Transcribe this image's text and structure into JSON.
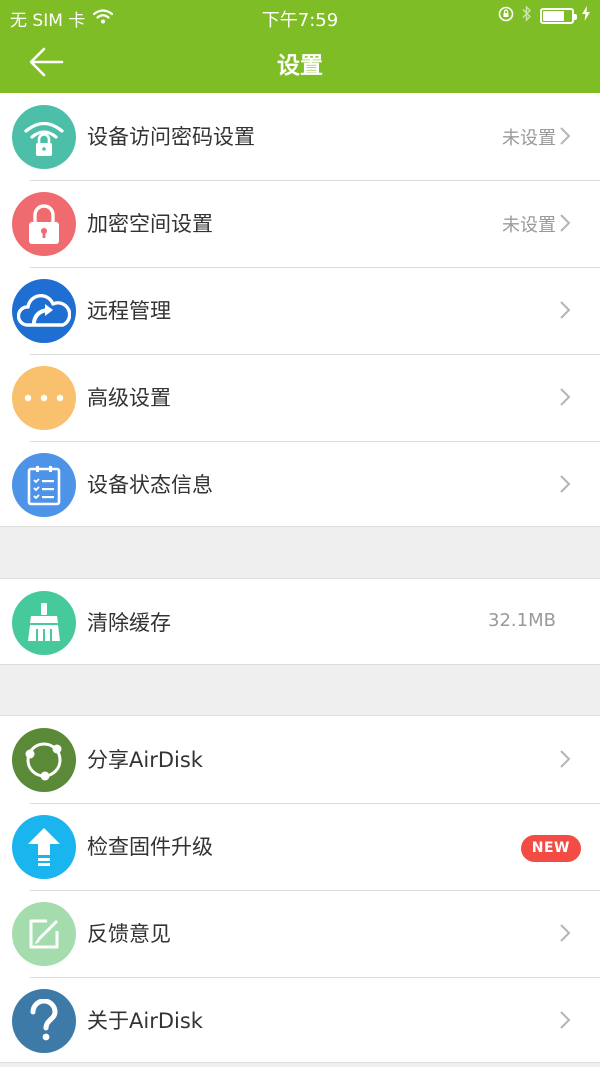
{
  "status_bar": {
    "carrier": "无 SIM 卡",
    "time": "下午7:59",
    "battery_level_percent": 75,
    "icons": [
      "wifi-icon",
      "orientation-lock-icon",
      "bluetooth-icon",
      "battery-icon",
      "charging-icon"
    ]
  },
  "nav": {
    "title": "设置",
    "back_icon": "back-arrow-icon"
  },
  "colors": {
    "nav_background": "#7fbd26",
    "badge_new": "#f24c45"
  },
  "groups": [
    {
      "items": [
        {
          "label": "设备访问密码设置",
          "value": "未设置",
          "icon": "wifi-lock-icon",
          "color": "#4dbfa8"
        },
        {
          "label": "加密空间设置",
          "value": "未设置",
          "icon": "padlock-icon",
          "color": "#f06b6f"
        },
        {
          "label": "远程管理",
          "value": "",
          "icon": "cloud-arrow-icon",
          "color": "#1e6fd1"
        },
        {
          "label": "高级设置",
          "value": "",
          "icon": "more-dots-icon",
          "color": "#f9c06d"
        },
        {
          "label": "设备状态信息",
          "value": "",
          "icon": "clipboard-list-icon",
          "color": "#4d93e8"
        }
      ]
    },
    {
      "items": [
        {
          "label": "清除缓存",
          "value": "32.1MB",
          "icon": "broom-icon",
          "color": "#46c99b"
        }
      ]
    },
    {
      "items": [
        {
          "label": "分享AirDisk",
          "value": "",
          "icon": "share-nodes-icon",
          "color": "#5a8a37"
        },
        {
          "label": "检查固件升级",
          "badge": "NEW",
          "icon": "upload-arrow-icon",
          "color": "#1ab4ef"
        },
        {
          "label": "反馈意见",
          "value": "",
          "icon": "edit-square-icon",
          "color": "#a4dcae"
        },
        {
          "label": "关于AirDisk",
          "value": "",
          "icon": "question-mark-icon",
          "color": "#3d7aa8"
        }
      ]
    }
  ]
}
